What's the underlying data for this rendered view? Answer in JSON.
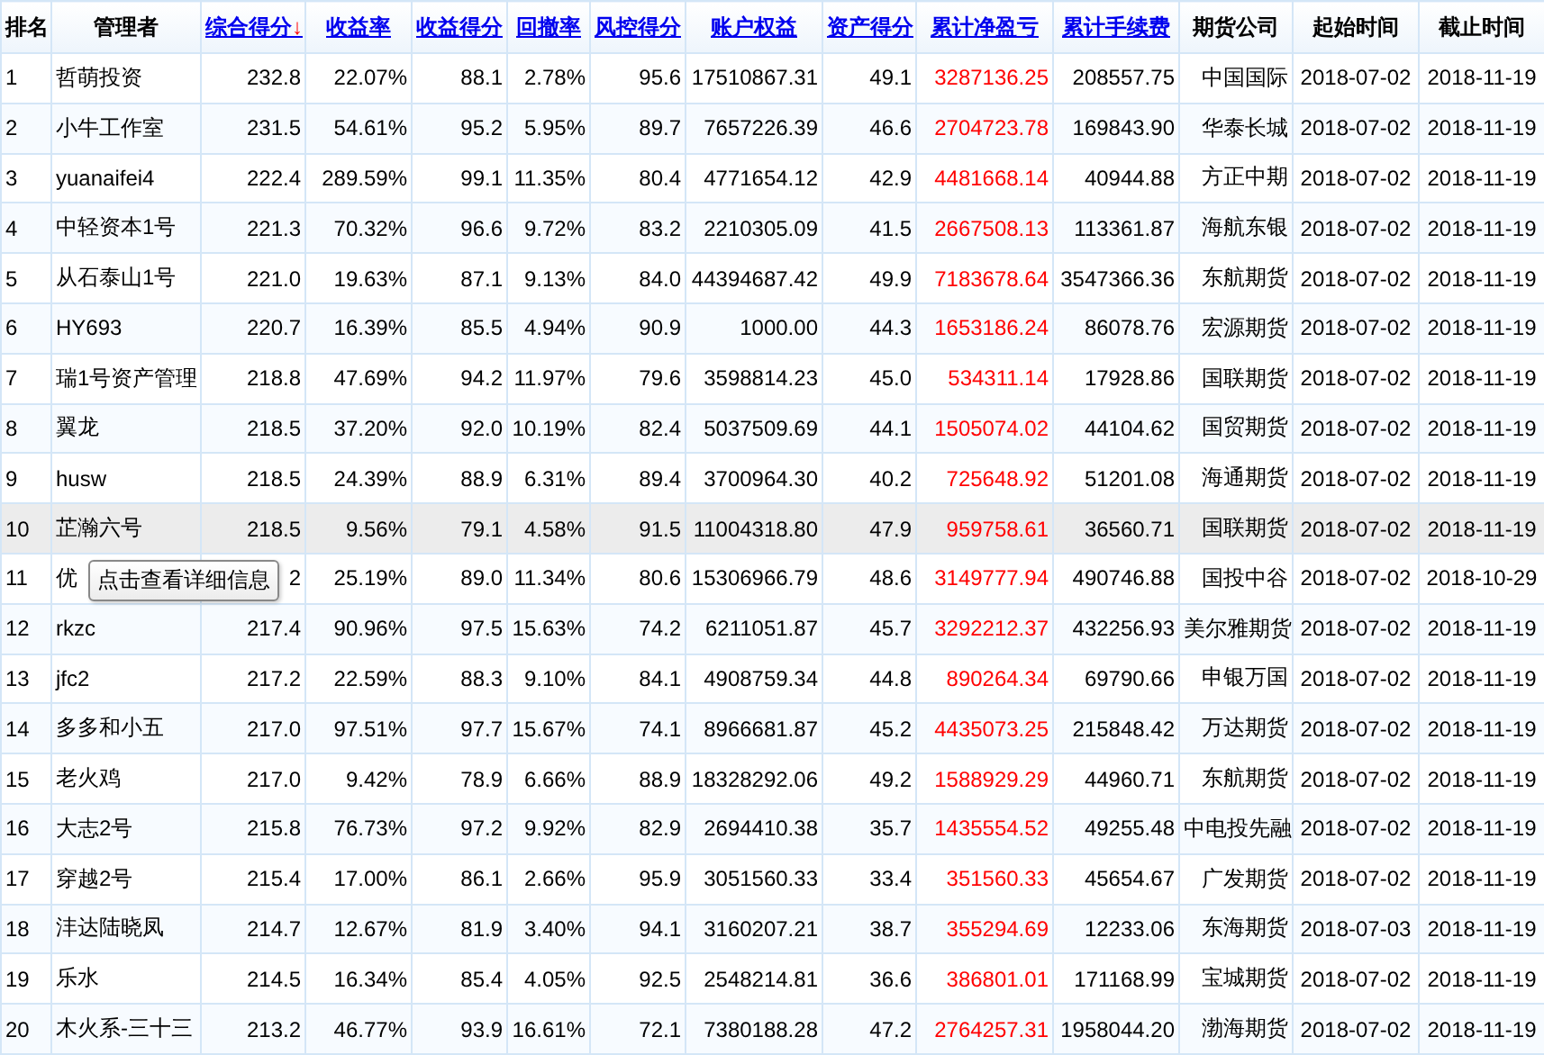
{
  "columns": [
    {
      "label": "排名",
      "kind": "rank",
      "sortable": false
    },
    {
      "label": "管理者",
      "kind": "text",
      "sortable": false
    },
    {
      "label": "综合得分",
      "kind": "number",
      "sortable": true,
      "sort_mark": "↓"
    },
    {
      "label": "收益率",
      "kind": "number",
      "sortable": true
    },
    {
      "label": "收益得分",
      "kind": "number",
      "sortable": true
    },
    {
      "label": "回撤率",
      "kind": "number",
      "sortable": true
    },
    {
      "label": "风控得分",
      "kind": "number",
      "sortable": true
    },
    {
      "label": "账户权益",
      "kind": "number",
      "sortable": true
    },
    {
      "label": "资产得分",
      "kind": "number",
      "sortable": true
    },
    {
      "label": "累计净盈亏",
      "kind": "profit",
      "sortable": true
    },
    {
      "label": "累计手续费",
      "kind": "number",
      "sortable": true
    },
    {
      "label": "期货公司",
      "kind": "number",
      "sortable": false
    },
    {
      "label": "起始时间",
      "kind": "date",
      "sortable": false
    },
    {
      "label": "截止时间",
      "kind": "date",
      "sortable": false
    }
  ],
  "rows": [
    {
      "hovered": false,
      "cells": [
        "1",
        "哲萌投资",
        "232.8",
        "22.07%",
        "88.1",
        "2.78%",
        "95.6",
        "17510867.31",
        "49.1",
        "3287136.25",
        "208557.75",
        "中国国际",
        "2018-07-02",
        "2018-11-19"
      ]
    },
    {
      "hovered": false,
      "cells": [
        "2",
        "小牛工作室",
        "231.5",
        "54.61%",
        "95.2",
        "5.95%",
        "89.7",
        "7657226.39",
        "46.6",
        "2704723.78",
        "169843.90",
        "华泰长城",
        "2018-07-02",
        "2018-11-19"
      ]
    },
    {
      "hovered": false,
      "cells": [
        "3",
        "yuanaifei4",
        "222.4",
        "289.59%",
        "99.1",
        "11.35%",
        "80.4",
        "4771654.12",
        "42.9",
        "4481668.14",
        "40944.88",
        "方正中期",
        "2018-07-02",
        "2018-11-19"
      ]
    },
    {
      "hovered": false,
      "cells": [
        "4",
        "中轻资本1号",
        "221.3",
        "70.32%",
        "96.6",
        "9.72%",
        "83.2",
        "2210305.09",
        "41.5",
        "2667508.13",
        "113361.87",
        "海航东银",
        "2018-07-02",
        "2018-11-19"
      ]
    },
    {
      "hovered": false,
      "cells": [
        "5",
        "从石泰山1号",
        "221.0",
        "19.63%",
        "87.1",
        "9.13%",
        "84.0",
        "44394687.42",
        "49.9",
        "7183678.64",
        "3547366.36",
        "东航期货",
        "2018-07-02",
        "2018-11-19"
      ]
    },
    {
      "hovered": false,
      "cells": [
        "6",
        "HY693",
        "220.7",
        "16.39%",
        "85.5",
        "4.94%",
        "90.9",
        "1000.00",
        "44.3",
        "1653186.24",
        "86078.76",
        "宏源期货",
        "2018-07-02",
        "2018-11-19"
      ]
    },
    {
      "hovered": false,
      "cells": [
        "7",
        "瑞1号资产管理",
        "218.8",
        "47.69%",
        "94.2",
        "11.97%",
        "79.6",
        "3598814.23",
        "45.0",
        "534311.14",
        "17928.86",
        "国联期货",
        "2018-07-02",
        "2018-11-19"
      ]
    },
    {
      "hovered": false,
      "cells": [
        "8",
        "翼龙",
        "218.5",
        "37.20%",
        "92.0",
        "10.19%",
        "82.4",
        "5037509.69",
        "44.1",
        "1505074.02",
        "44104.62",
        "国贸期货",
        "2018-07-02",
        "2018-11-19"
      ]
    },
    {
      "hovered": false,
      "cells": [
        "9",
        "husw",
        "218.5",
        "24.39%",
        "88.9",
        "6.31%",
        "89.4",
        "3700964.30",
        "40.2",
        "725648.92",
        "51201.08",
        "海通期货",
        "2018-07-02",
        "2018-11-19"
      ]
    },
    {
      "hovered": true,
      "cells": [
        "10",
        "芷瀚六号",
        "218.5",
        "9.56%",
        "79.1",
        "4.58%",
        "91.5",
        "11004318.80",
        "47.9",
        "959758.61",
        "36560.71",
        "国联期货",
        "2018-07-02",
        "2018-11-19"
      ]
    },
    {
      "hovered": false,
      "tooltip": "点击查看详细信息",
      "cells": [
        "11",
        "优",
        "2",
        "25.19%",
        "89.0",
        "11.34%",
        "80.6",
        "15306966.79",
        "48.6",
        "3149777.94",
        "490746.88",
        "国投中谷",
        "2018-07-02",
        "2018-10-29"
      ]
    },
    {
      "hovered": false,
      "cells": [
        "12",
        "rkzc",
        "217.4",
        "90.96%",
        "97.5",
        "15.63%",
        "74.2",
        "6211051.87",
        "45.7",
        "3292212.37",
        "432256.93",
        "美尔雅期货",
        "2018-07-02",
        "2018-11-19"
      ]
    },
    {
      "hovered": false,
      "cells": [
        "13",
        "jfc2",
        "217.2",
        "22.59%",
        "88.3",
        "9.10%",
        "84.1",
        "4908759.34",
        "44.8",
        "890264.34",
        "69790.66",
        "申银万国",
        "2018-07-02",
        "2018-11-19"
      ]
    },
    {
      "hovered": false,
      "cells": [
        "14",
        "多多和小五",
        "217.0",
        "97.51%",
        "97.7",
        "15.67%",
        "74.1",
        "8966681.87",
        "45.2",
        "4435073.25",
        "215848.42",
        "万达期货",
        "2018-07-02",
        "2018-11-19"
      ]
    },
    {
      "hovered": false,
      "cells": [
        "15",
        "老火鸡",
        "217.0",
        "9.42%",
        "78.9",
        "6.66%",
        "88.9",
        "18328292.06",
        "49.2",
        "1588929.29",
        "44960.71",
        "东航期货",
        "2018-07-02",
        "2018-11-19"
      ]
    },
    {
      "hovered": false,
      "cells": [
        "16",
        "大志2号",
        "215.8",
        "76.73%",
        "97.2",
        "9.92%",
        "82.9",
        "2694410.38",
        "35.7",
        "1435554.52",
        "49255.48",
        "中电投先融",
        "2018-07-02",
        "2018-11-19"
      ]
    },
    {
      "hovered": false,
      "cells": [
        "17",
        "穿越2号",
        "215.4",
        "17.00%",
        "86.1",
        "2.66%",
        "95.9",
        "3051560.33",
        "33.4",
        "351560.33",
        "45654.67",
        "广发期货",
        "2018-07-02",
        "2018-11-19"
      ]
    },
    {
      "hovered": false,
      "cells": [
        "18",
        "沣达陆晓凤",
        "214.7",
        "12.67%",
        "81.9",
        "3.40%",
        "94.1",
        "3160207.21",
        "38.7",
        "355294.69",
        "12233.06",
        "东海期货",
        "2018-07-03",
        "2018-11-19"
      ]
    },
    {
      "hovered": false,
      "cells": [
        "19",
        "乐水",
        "214.5",
        "16.34%",
        "85.4",
        "4.05%",
        "92.5",
        "2548214.81",
        "36.6",
        "386801.01",
        "171168.99",
        "宝城期货",
        "2018-07-02",
        "2018-11-19"
      ]
    },
    {
      "hovered": false,
      "cells": [
        "20",
        "木火系-三十三",
        "213.2",
        "46.77%",
        "93.9",
        "16.61%",
        "72.1",
        "7380188.28",
        "47.2",
        "2764257.31",
        "1958044.20",
        "渤海期货",
        "2018-07-02",
        "2018-11-19"
      ]
    }
  ]
}
